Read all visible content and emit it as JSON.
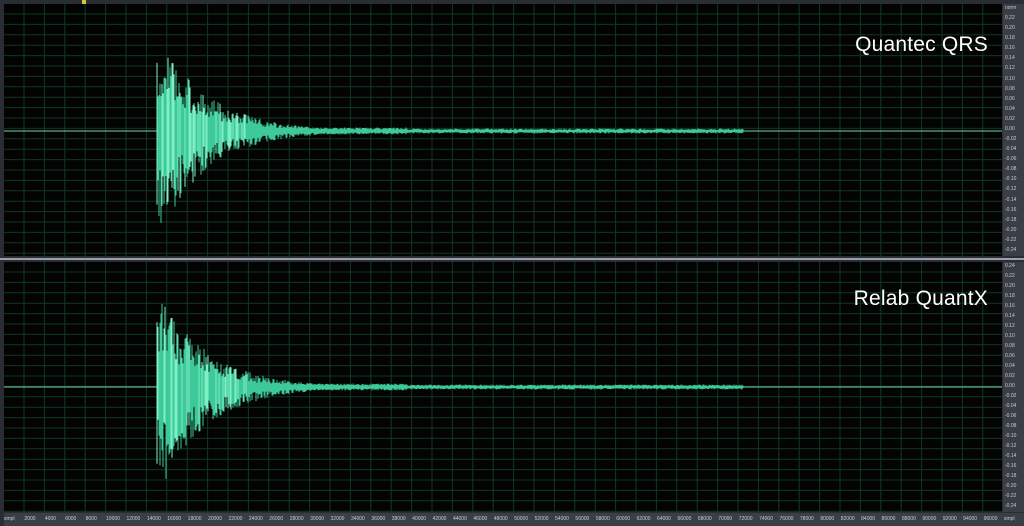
{
  "tracks": [
    {
      "title": "Quantec QRS"
    },
    {
      "title": "Relab QuantX"
    }
  ],
  "amplitude_ruler_labels": [
    "norm",
    "0.22",
    "0.20",
    "0.18",
    "0.16",
    "0.14",
    "0.12",
    "0.10",
    "0.08",
    "0.06",
    "0.04",
    "0.02",
    "0.00",
    "-0.02",
    "-0.04",
    "-0.06",
    "-0.08",
    "-0.10",
    "-0.12",
    "-0.14",
    "-0.16",
    "-0.18",
    "-0.20",
    "-0.22",
    "-0.24"
  ],
  "amplitude_ruler_labels_bottom": [
    "0.24",
    "0.22",
    "0.20",
    "0.18",
    "0.16",
    "0.14",
    "0.12",
    "0.10",
    "0.08",
    "0.06",
    "0.04",
    "0.02",
    "0.00",
    "-0.02",
    "-0.04",
    "-0.06",
    "-0.08",
    "-0.10",
    "-0.12",
    "-0.14",
    "-0.16",
    "-0.18",
    "-0.20",
    "-0.22",
    "-0.24"
  ],
  "time_ruler_labels": [
    "smpl",
    "2000",
    "4000",
    "6000",
    "8000",
    "10000",
    "12000",
    "14000",
    "16000",
    "18000",
    "20000",
    "22000",
    "24000",
    "26000",
    "28000",
    "30000",
    "32000",
    "34000",
    "36000",
    "38000",
    "40000",
    "42000",
    "44000",
    "46000",
    "48000",
    "50000",
    "52000",
    "54000",
    "56000",
    "58000",
    "60000",
    "62000",
    "64000",
    "66000",
    "68000",
    "70000",
    "72000",
    "74000",
    "76000",
    "78000",
    "80000",
    "82000",
    "84000",
    "86000",
    "88000",
    "90000",
    "92000",
    "94000",
    "96000",
    "smpl"
  ],
  "colors": {
    "waveform": "#3ec99a",
    "waveform_bright": "#7ff0c4",
    "grid": "#0f3a1c",
    "centerline": "#6fd4a8",
    "background": "#030303"
  }
}
